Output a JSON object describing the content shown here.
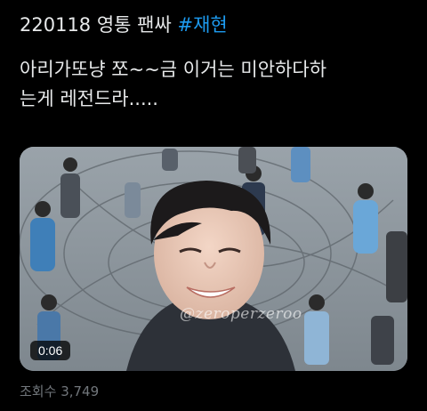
{
  "tweet": {
    "date": "220118",
    "header_text": "영통 팬싸",
    "hashtag": "#재현",
    "body_line1": "아리가또냥 쪼~~금 이거는 미안하다하",
    "body_line2": "는게 레전드라....."
  },
  "media": {
    "duration": "0:06",
    "watermark": "@zeroperzeroo"
  },
  "stats": {
    "views_label": "조회수",
    "views_count": "3,749"
  },
  "colors": {
    "background": "#000000",
    "text": "#e7e9ea",
    "hashtag": "#1d9bf0",
    "secondary": "#71767b"
  }
}
